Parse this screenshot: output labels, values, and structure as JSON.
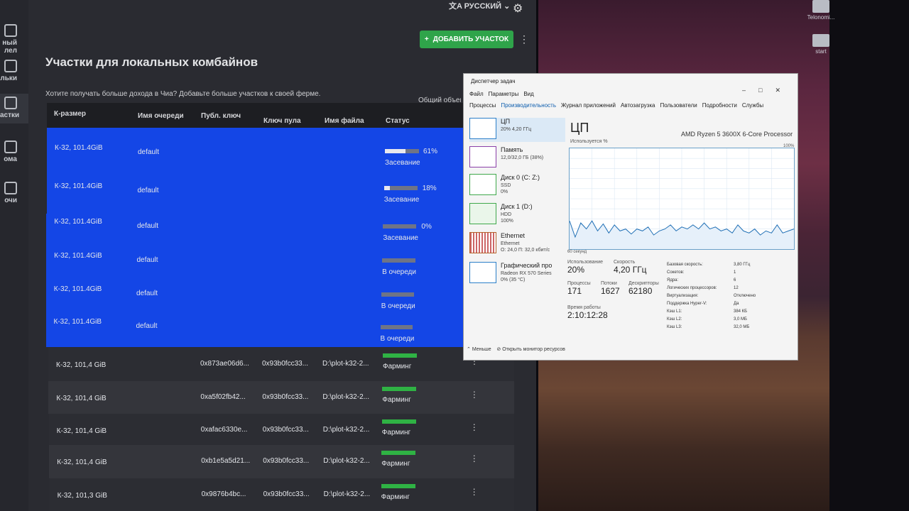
{
  "app": {
    "language": "РУССКИЙ",
    "add_plot_button": "ДОБАВИТЬ УЧАСТОК",
    "title": "Участки для локальных комбайнов",
    "subtitle": "Хотите получать больше дохода в Чиа? Добавьте больше участков к своей ферме.",
    "total_size_label": "Общий объем у",
    "sidebar": [
      {
        "label": "ный\nлел",
        "icon": "wallet-icon"
      },
      {
        "label": "льки",
        "icon": "farm-icon"
      },
      {
        "label": "астки",
        "icon": "plots-icon"
      },
      {
        "label": "ома",
        "icon": "pool-icon"
      },
      {
        "label": "очи",
        "icon": "help-icon"
      }
    ],
    "columns": [
      "К-размер",
      "Имя очереди",
      "Публ. ключ",
      "Ключ пула",
      "Имя файла",
      "Статус"
    ],
    "queue_rows": [
      {
        "size": "К-32, 101.4GiB",
        "queue": "default",
        "progress": 0.61,
        "progress_text": "61%",
        "status": "Засевание"
      },
      {
        "size": "К-32, 101.4GiB",
        "queue": "default",
        "progress": 0.18,
        "progress_text": "18%",
        "status": "Засевание"
      },
      {
        "size": "К-32, 101.4GiB",
        "queue": "default",
        "progress": 0.0,
        "progress_text": "0%",
        "status": "Засевание"
      },
      {
        "size": "К-32, 101.4GiB",
        "queue": "default",
        "progress": 0.0,
        "progress_text": "",
        "status": "В очереди"
      },
      {
        "size": "К-32, 101.4GiB",
        "queue": "default",
        "progress": 0.0,
        "progress_text": "",
        "status": "В очереди"
      },
      {
        "size": "К-32, 101.4GiB",
        "queue": "default",
        "progress": 0.0,
        "progress_text": "",
        "status": "В очереди"
      }
    ],
    "farm_rows": [
      {
        "size": "К-32, 101,4 GiB",
        "pubkey": "0x873ae06d6...",
        "poolkey": "0x93b0fcc33...",
        "file": "D:\\plot-k32-2...",
        "status": "Фарминг"
      },
      {
        "size": "К-32, 101,4 GiB",
        "pubkey": "0xa5f02fb42...",
        "poolkey": "0x93b0fcc33...",
        "file": "D:\\plot-k32-2...",
        "status": "Фарминг"
      },
      {
        "size": "К-32, 101,4 GiB",
        "pubkey": "0xafac6330e...",
        "poolkey": "0x93b0fcc33...",
        "file": "D:\\plot-k32-2...",
        "status": "Фарминг"
      },
      {
        "size": "К-32, 101,4 GiB",
        "pubkey": "0xb1e5a5d21...",
        "poolkey": "0x93b0fcc33...",
        "file": "D:\\plot-k32-2...",
        "status": "Фарминг"
      },
      {
        "size": "К-32, 101,3 GiB",
        "pubkey": "0x9876b4bc...",
        "poolkey": "0x93b0fcc33...",
        "file": "D:\\plot-k32-2...",
        "status": "Фарминг"
      }
    ]
  },
  "desktop": {
    "icons": [
      {
        "label": "Telonomi..."
      },
      {
        "label": "start"
      }
    ]
  },
  "task_manager": {
    "title": "Диспетчер задач",
    "menu": [
      "Файл",
      "Параметры",
      "Вид"
    ],
    "tabs": [
      "Процессы",
      "Производительность",
      "Журнал приложений",
      "Автозагрузка",
      "Пользователи",
      "Подробности",
      "Службы"
    ],
    "tiles": [
      {
        "name": "ЦП",
        "sub": "20% 4,20 ГГц"
      },
      {
        "name": "Память",
        "sub": "12,0/32,0 ГБ (38%)"
      },
      {
        "name": "Диск 0 (C: Z:)",
        "sub": "SSD\n0%"
      },
      {
        "name": "Диск 1 (D:)",
        "sub": "HDD\n100%"
      },
      {
        "name": "Ethernet",
        "sub": "Ethernet\nО: 24,0 П: 32,0 кбит/с"
      },
      {
        "name": "Графический про",
        "sub": "Radeon RX 570 Series\n0% (35 °C)"
      }
    ],
    "heading": "ЦП",
    "cpu_name": "AMD Ryzen 5 3600X 6-Core Processor",
    "usage_label": "Используется %",
    "max_label": "100%",
    "seconds_label": "60 секунд",
    "cpu_history": [
      0.28,
      0.12,
      0.26,
      0.2,
      0.28,
      0.18,
      0.25,
      0.16,
      0.24,
      0.18,
      0.2,
      0.15,
      0.2,
      0.18,
      0.22,
      0.14,
      0.18,
      0.2,
      0.24,
      0.18,
      0.22,
      0.2,
      0.24,
      0.2,
      0.26,
      0.2,
      0.22,
      0.18,
      0.2,
      0.16,
      0.24,
      0.18,
      0.16,
      0.2,
      0.14,
      0.18,
      0.16,
      0.24,
      0.16,
      0.18,
      0.2
    ],
    "stats": {
      "utilization_label": "Использование",
      "utilization": "20%",
      "speed_label": "Скорость",
      "speed": "4,20 ГГц",
      "processes_label": "Процессы",
      "processes": "171",
      "threads_label": "Потоки",
      "threads": "1627",
      "handles_label": "Дескрипторы",
      "handles": "62180",
      "uptime_label": "Время работы",
      "uptime": "2:10:12:28"
    },
    "props": [
      [
        "Базовая скорость:",
        "3,80 ГГц"
      ],
      [
        "Сокетов:",
        "1"
      ],
      [
        "Ядра:",
        "6"
      ],
      [
        "Логических процессоров:",
        "12"
      ],
      [
        "Виртуализация:",
        "Отключено"
      ],
      [
        "Поддержка Hyper-V:",
        "Да"
      ],
      [
        "Кэш L1:",
        "384 КБ"
      ],
      [
        "Кэш L2:",
        "3,0 МБ"
      ],
      [
        "Кэш L3:",
        "32,0 МБ"
      ]
    ],
    "fewer_details": "Меньше",
    "resource_monitor": "Открыть монитор ресурсов"
  }
}
